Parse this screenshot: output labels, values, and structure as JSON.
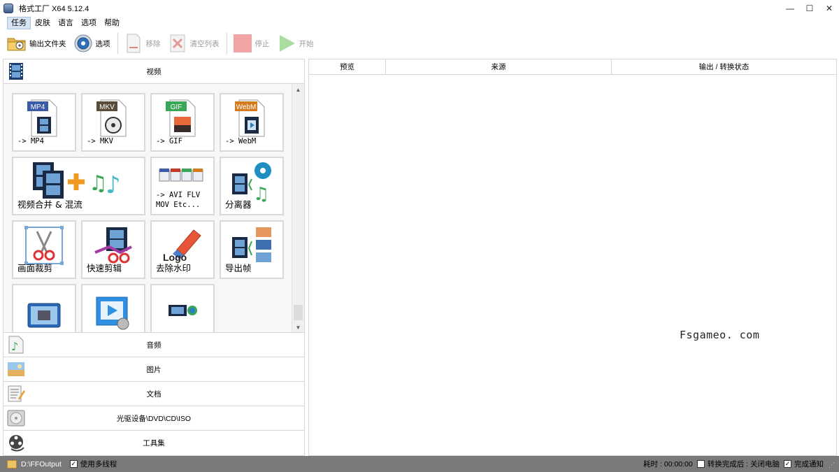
{
  "window": {
    "title": "格式工厂 X64 5.12.4",
    "controls": {
      "minimize": "—",
      "maximize": "☐",
      "close": "✕"
    }
  },
  "menu": [
    "任务",
    "皮肤",
    "语言",
    "选项",
    "帮助"
  ],
  "toolbar": {
    "output_folder": "输出文件夹",
    "options": "选项",
    "remove": "移除",
    "clear_list": "清空列表",
    "stop": "停止",
    "start": "开始"
  },
  "left": {
    "video_header": "视频",
    "tiles": [
      {
        "label": "-> MP4",
        "badge": "MP4",
        "badge_color": "#3b5ba8"
      },
      {
        "label": "-> MKV",
        "badge": "MKV",
        "badge_color": "#5a4a3a"
      },
      {
        "label": "-> GIF",
        "badge": "GIF",
        "badge_color": "#3aa657"
      },
      {
        "label": "-> WebM",
        "badge": "WebM",
        "badge_color": "#d47b1e"
      },
      {
        "label": "视频合并 & 混流"
      },
      {
        "label": "-> AVI FLV\nMOV Etc..."
      },
      {
        "label": "分离器"
      },
      {
        "label": "画面裁剪"
      },
      {
        "label": "快速剪辑"
      },
      {
        "label": "去除水印",
        "logo_text": "Logo"
      },
      {
        "label": "导出帧"
      }
    ],
    "categories": {
      "audio": "音频",
      "image": "图片",
      "document": "文档",
      "disc": "光驱设备\\DVD\\CD\\ISO",
      "tools": "工具集"
    }
  },
  "right": {
    "columns": [
      "预览",
      "来源",
      "输出 / 转换状态"
    ],
    "watermark": "Fsgameo. com"
  },
  "status": {
    "output_path": "D:\\FFOutput",
    "multithread": "使用多线程",
    "elapsed": "耗时 : 00:00:00",
    "after_done": "转换完成后 : 关闭电脑",
    "notify": "完成通知"
  }
}
